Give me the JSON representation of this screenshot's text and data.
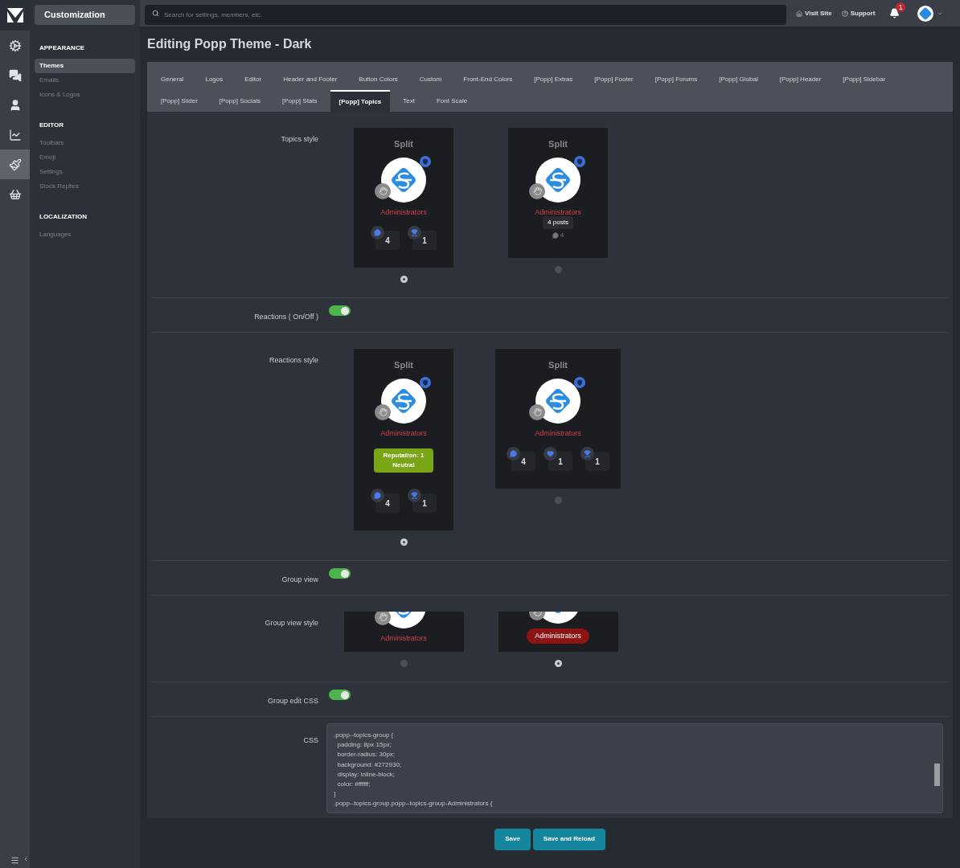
{
  "rail": [
    {
      "selected": false
    },
    {
      "selected": false
    },
    {
      "selected": false
    },
    {
      "selected": false
    },
    {
      "selected": true
    },
    {
      "selected": false
    }
  ],
  "nav": {
    "title": "Customization",
    "sections": [
      {
        "heading": "APPEARANCE",
        "items": [
          {
            "label": "Themes",
            "selected": true
          },
          {
            "label": "Emails",
            "selected": false
          },
          {
            "label": "Icons & Logos",
            "selected": false
          }
        ]
      },
      {
        "heading": "EDITOR",
        "items": [
          {
            "label": "Toolbars",
            "selected": false
          },
          {
            "label": "Emoji",
            "selected": false
          },
          {
            "label": "Settings",
            "selected": false
          },
          {
            "label": "Stock Replies",
            "selected": false
          }
        ]
      },
      {
        "heading": "LOCALIZATION",
        "items": [
          {
            "label": "Languages",
            "selected": false
          }
        ]
      }
    ]
  },
  "topbar": {
    "search": {
      "placeholder": "Search for settings, members, etc."
    },
    "links": [
      "Visit Site",
      "Support"
    ],
    "notifications": "1"
  },
  "page_title": "Editing Popp Theme - Dark",
  "tab_rows": [
    [
      {
        "label": "General",
        "selected": false
      },
      {
        "label": "Logos",
        "selected": false
      },
      {
        "label": "Editor",
        "selected": false
      },
      {
        "label": "Header and Footer",
        "selected": false
      },
      {
        "label": "Button Colors",
        "selected": false
      },
      {
        "label": "Custom",
        "selected": false
      },
      {
        "label": "Front-End Colors",
        "selected": false
      },
      {
        "label": "[Popp] Extras",
        "selected": false
      },
      {
        "label": "[Popp] Footer",
        "selected": false
      },
      {
        "label": "[Popp] Forums",
        "selected": false
      },
      {
        "label": "[Popp] Global",
        "selected": false
      },
      {
        "label": "[Popp] Header",
        "selected": false
      },
      {
        "label": "[Popp] Sidebar",
        "selected": false
      }
    ],
    [
      {
        "label": "[Popp] Slider",
        "selected": false
      },
      {
        "label": "[Popp] Socials",
        "selected": false
      },
      {
        "label": "[Popp] Stats",
        "selected": false
      },
      {
        "label": "[Popp] Topics",
        "selected": true
      },
      {
        "label": "Text",
        "selected": false
      },
      {
        "label": "Font Scale",
        "selected": false
      }
    ]
  ],
  "settings": [
    {
      "kind": "choices",
      "label": "Topics style",
      "options": [
        {
          "selected": true,
          "preview": {
            "kind": "full",
            "title": "Split",
            "group": {
              "kind": "text",
              "text": "Administrators"
            },
            "stats": [
              {
                "kind": "posts",
                "value": "4"
              },
              {
                "kind": "trophies",
                "value": "1"
              }
            ]
          }
        },
        {
          "selected": false,
          "preview": {
            "kind": "full",
            "title": "Split",
            "group": {
              "kind": "text",
              "text": "Administrators"
            },
            "tooltip": "4 posts",
            "count": "4"
          }
        }
      ]
    },
    {
      "kind": "toggle",
      "label": "Reactions ( On/Off )",
      "on": true
    },
    {
      "kind": "choices",
      "label": "Reactions style",
      "options": [
        {
          "selected": true,
          "preview": {
            "kind": "full",
            "title": "Split",
            "group": {
              "kind": "text",
              "text": "Administrators"
            },
            "reputation": [
              "Reputation: 1",
              "Neutral"
            ],
            "stats": [
              {
                "kind": "posts",
                "value": "4"
              },
              {
                "kind": "trophies",
                "value": "1"
              }
            ]
          }
        },
        {
          "selected": false,
          "preview": {
            "kind": "full",
            "title": "Split",
            "group": {
              "kind": "text",
              "text": "Administrators"
            },
            "stats": [
              {
                "kind": "posts",
                "value": "4"
              },
              {
                "kind": "reactions",
                "value": "1"
              },
              {
                "kind": "trophies",
                "value": "1"
              }
            ]
          }
        }
      ]
    },
    {
      "kind": "toggle",
      "label": "Group view",
      "on": true
    },
    {
      "kind": "choices",
      "label": "Group view style",
      "options": [
        {
          "selected": false,
          "preview": {
            "kind": "cropped",
            "group": {
              "kind": "text",
              "text": "Administrators"
            }
          }
        },
        {
          "selected": true,
          "preview": {
            "kind": "cropped",
            "group": {
              "kind": "pill",
              "text": "Administrators"
            }
          }
        }
      ]
    },
    {
      "kind": "toggle",
      "label": "Group edit CSS",
      "on": true
    },
    {
      "kind": "code",
      "label": "CSS",
      "lines": [
        ".popp--topics-group {",
        "  padding: 8px 15px;",
        "  border-radius: 30px;",
        "  background: #272930;",
        "  display: inline-block;",
        "  color: #ffffff;",
        "}",
        ".popp--topics-group.popp--topics-group-Administrators {"
      ]
    }
  ],
  "buttons": [
    "Save",
    "Save and Reload"
  ]
}
